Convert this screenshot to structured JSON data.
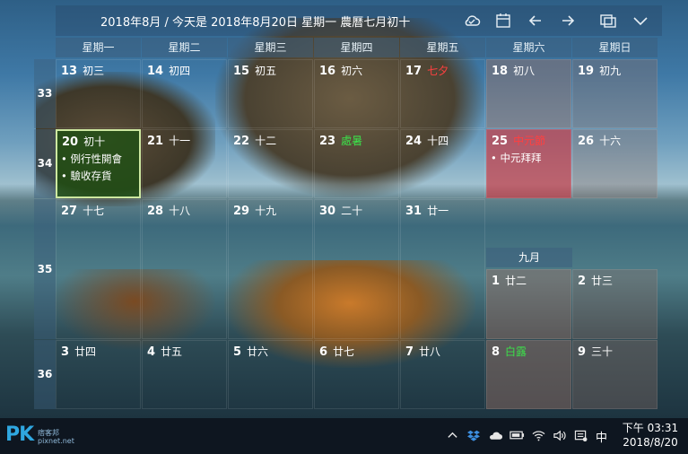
{
  "header": {
    "title": "2018年8月 / 今天是 2018年8月20日 星期一 農曆七月初十"
  },
  "weekdays": [
    "星期一",
    "星期二",
    "星期三",
    "星期四",
    "星期五",
    "星期六",
    "星期日"
  ],
  "week_numbers": [
    "33",
    "34",
    "35",
    "36"
  ],
  "weeks": [
    [
      {
        "day": "13",
        "lunar": "初三"
      },
      {
        "day": "14",
        "lunar": "初四"
      },
      {
        "day": "15",
        "lunar": "初五"
      },
      {
        "day": "16",
        "lunar": "初六"
      },
      {
        "day": "17",
        "lunar": "七夕"
      },
      {
        "day": "18",
        "lunar": "初八"
      },
      {
        "day": "19",
        "lunar": "初九"
      }
    ],
    [
      {
        "day": "20",
        "lunar": "初十"
      },
      {
        "day": "21",
        "lunar": "十一"
      },
      {
        "day": "22",
        "lunar": "十二"
      },
      {
        "day": "23",
        "lunar": "處暑"
      },
      {
        "day": "24",
        "lunar": "十四"
      },
      {
        "day": "25",
        "lunar": "中元節"
      },
      {
        "day": "26",
        "lunar": "十六"
      }
    ],
    [
      {
        "day": "27",
        "lunar": "十七"
      },
      {
        "day": "28",
        "lunar": "十八"
      },
      {
        "day": "29",
        "lunar": "十九"
      },
      {
        "day": "30",
        "lunar": "二十"
      },
      {
        "day": "31",
        "lunar": "廿一"
      }
    ]
  ],
  "events": {
    "aug20": [
      "• 例行性開會",
      "• 驗收存貨"
    ],
    "aug25": [
      "• 中元拜拜"
    ]
  },
  "september": {
    "label": "九月",
    "row1": [
      {
        "day": "1",
        "lunar": "廿二"
      },
      {
        "day": "2",
        "lunar": "廿三"
      }
    ],
    "row2": [
      {
        "day": "3",
        "lunar": "廿四"
      },
      {
        "day": "4",
        "lunar": "廿五"
      },
      {
        "day": "5",
        "lunar": "廿六"
      },
      {
        "day": "6",
        "lunar": "廿七"
      },
      {
        "day": "7",
        "lunar": "廿八"
      },
      {
        "day": "8",
        "lunar": "白露"
      },
      {
        "day": "9",
        "lunar": "三十"
      }
    ]
  },
  "taskbar": {
    "logo": "PK",
    "logo_sub": "痞客邦\npixnet.net",
    "ime": "中",
    "time": "下午 03:31",
    "date": "2018/8/20"
  },
  "colors": {
    "holiday": "#ff4040",
    "solar_term": "#3ce04a",
    "today_bg": "#1e5014",
    "selected_bg": "#c83c46"
  }
}
